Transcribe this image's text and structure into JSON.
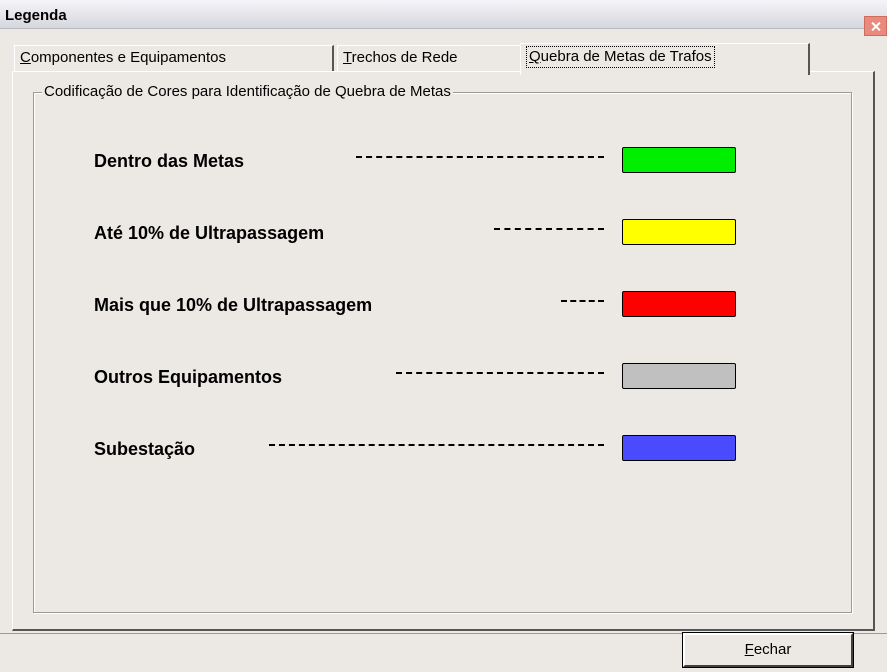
{
  "window": {
    "title": "Legenda"
  },
  "tabs": [
    {
      "label_ul": "C",
      "label_rest": "omponentes e Equipamentos"
    },
    {
      "label_ul": "T",
      "label_rest": "rechos de Rede"
    },
    {
      "label_ul": "Q",
      "label_rest": "uebra de Metas de Trafos"
    }
  ],
  "active_tab": 2,
  "group": {
    "title": "Codificação de Cores para Identificação de Quebra de Metas"
  },
  "legend": [
    {
      "label": "Dentro das Metas",
      "color": "#00ee00"
    },
    {
      "label": "Até 10% de Ultrapassagem",
      "color": "#ffff00"
    },
    {
      "label": "Mais que 10% de Ultrapassagem",
      "color": "#ff0000"
    },
    {
      "label": "Outros Equipamentos",
      "color": "#c0c0c0"
    },
    {
      "label": "Subestação",
      "color": "#4a4aff"
    }
  ],
  "buttons": {
    "close_ul": "F",
    "close_rest": "echar"
  }
}
